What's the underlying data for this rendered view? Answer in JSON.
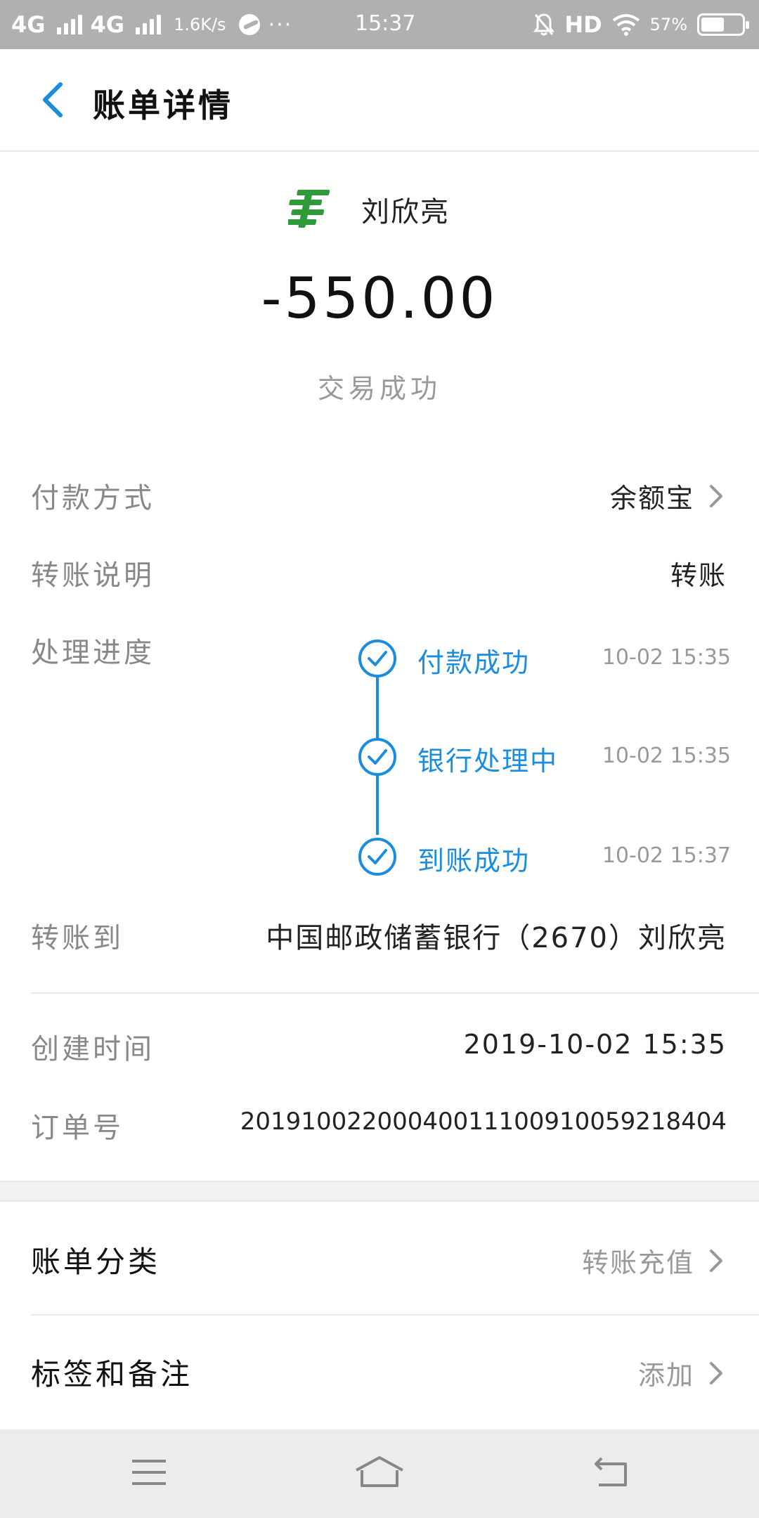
{
  "status_bar": {
    "network1": "4G",
    "network2": "4G",
    "speed": "1.6K/s",
    "dots": "···",
    "time": "15:37",
    "hd": "HD",
    "battery": "57%"
  },
  "header": {
    "title": "账单详情",
    "back_icon": "chevron-left-icon"
  },
  "summary": {
    "payee_icon": "china-post-logo",
    "payee_name": "刘欣亮",
    "amount": "-550.00",
    "status": "交易成功"
  },
  "details": {
    "payment_method": {
      "label": "付款方式",
      "value": "余额宝"
    },
    "transfer_note": {
      "label": "转账说明",
      "value": "转账"
    },
    "progress": {
      "label": "处理进度"
    },
    "transfer_to": {
      "label": "转账到",
      "value": "中国邮政储蓄银行（2670）刘欣亮"
    },
    "created_time": {
      "label": "创建时间",
      "value": "2019-10-02 15:35"
    },
    "order_no": {
      "label": "订单号",
      "value": "20191002200040011100910059218404"
    }
  },
  "timeline": {
    "steps": [
      {
        "text": "付款成功",
        "time": "10-02 15:35"
      },
      {
        "text": "银行处理中",
        "time": "10-02 15:35"
      },
      {
        "text": "到账成功",
        "time": "10-02 15:37"
      }
    ]
  },
  "extra": {
    "category": {
      "label": "账单分类",
      "value": "转账充值"
    },
    "tags": {
      "label": "标签和备注",
      "value": "添加"
    }
  },
  "colors": {
    "accent": "#1a8de0",
    "logo_green": "#2e9a3a",
    "status_bar": "#b0b0b0"
  }
}
